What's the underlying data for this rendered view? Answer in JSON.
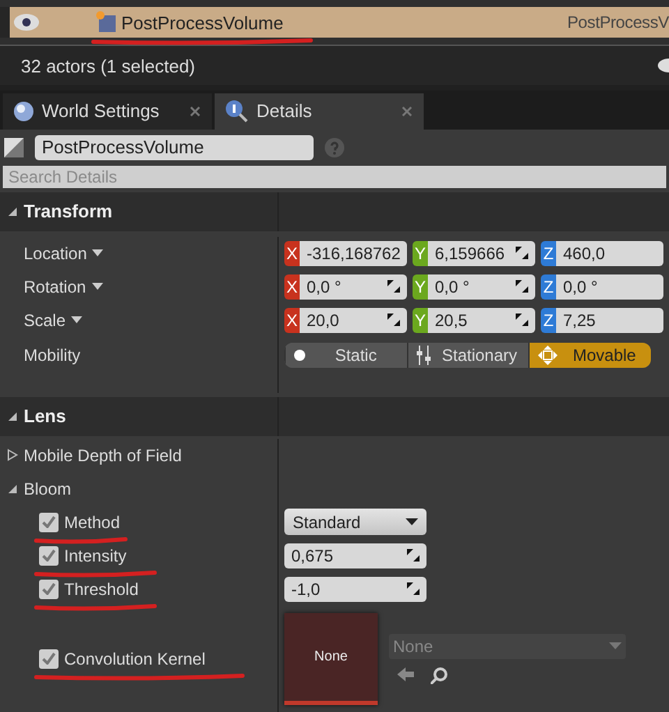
{
  "outliner": {
    "rows": [
      {
        "label": "PostProcessVolume",
        "type": "PostProcessV",
        "selected": true,
        "underlined": true
      }
    ]
  },
  "status_bar": {
    "text": "32 actors (1 selected)"
  },
  "tabs": [
    {
      "label": "World Settings",
      "kind": "globe",
      "selected": false
    },
    {
      "label": "Details",
      "kind": "info",
      "selected": true
    }
  ],
  "name_field": {
    "value": "PostProcessVolume"
  },
  "search": {
    "placeholder": "Search Details"
  },
  "transform": {
    "title": "Transform",
    "expanded": true,
    "rows": [
      {
        "label": "Location",
        "values": [
          {
            "axis": "X",
            "value": "-316,168762"
          },
          {
            "axis": "Y",
            "value": "6,159666"
          },
          {
            "axis": "Z",
            "value": "460,0"
          }
        ]
      },
      {
        "label": "Rotation",
        "values": [
          {
            "axis": "X",
            "value": "0,0 °"
          },
          {
            "axis": "Y",
            "value": "0,0 °"
          },
          {
            "axis": "Z",
            "value": "0,0 °"
          }
        ]
      },
      {
        "label": "Scale",
        "values": [
          {
            "axis": "X",
            "value": "20,0"
          },
          {
            "axis": "Y",
            "value": "20,5"
          },
          {
            "axis": "Z",
            "value": "7,25"
          }
        ]
      }
    ],
    "mobility": {
      "label": "Mobility",
      "options": [
        {
          "label": "Static",
          "kind": "dot",
          "selected": false
        },
        {
          "label": "Stationary",
          "kind": "bars",
          "selected": false
        },
        {
          "label": "Movable",
          "kind": "move",
          "selected": true
        }
      ]
    }
  },
  "lens": {
    "title": "Lens",
    "expanded": true,
    "groups": [
      {
        "label": "Mobile Depth of Field",
        "expanded": false
      },
      {
        "label": "Bloom",
        "expanded": true,
        "items": [
          {
            "kind": "dropdown",
            "label": "Method",
            "checked": true,
            "underlined": true,
            "value": "Standard"
          },
          {
            "kind": "number",
            "label": "Intensity",
            "checked": true,
            "underlined": true,
            "value": "0,675"
          },
          {
            "kind": "number",
            "label": "Threshold",
            "checked": true,
            "underlined": true,
            "value": "-1,0"
          },
          {
            "kind": "texture",
            "label": "Convolution Kernel",
            "checked": true,
            "underlined": true,
            "value": "None",
            "asset": "None"
          }
        ]
      }
    ]
  }
}
